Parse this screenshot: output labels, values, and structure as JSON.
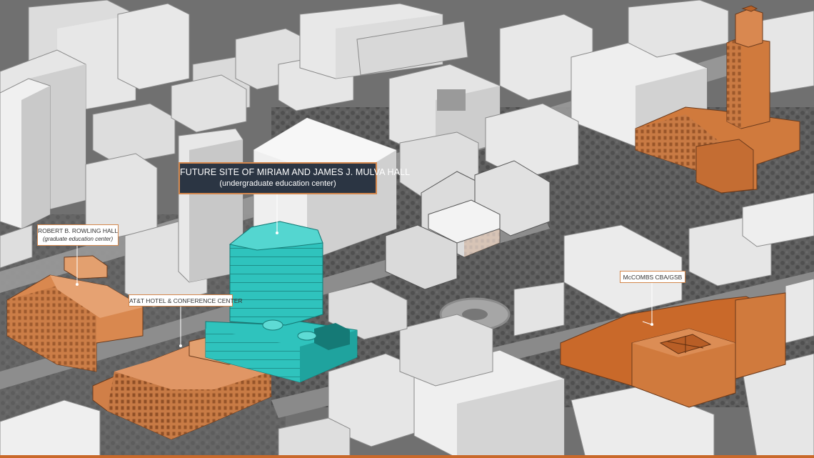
{
  "colors": {
    "accent_orange": "#c9692a",
    "campus_orange": "#d9884f",
    "highlight_teal": "#2fc3bd",
    "label_dark": "#2b3543",
    "building_white": "#e9e9e9"
  },
  "labels": {
    "mulva": {
      "line1": "FUTURE SITE OF MIRIAM AND JAMES J. MULVA HALL",
      "line2": "(undergraduate education center)"
    },
    "rowling": {
      "line1": "ROBERT B. ROWLING HALL",
      "line2": "(graduate education center)"
    },
    "att": {
      "line1": "AT&T HOTEL & CONFERENCE CENTER"
    },
    "mccombs": {
      "line1": "McCOMBS CBA/GSB"
    }
  }
}
